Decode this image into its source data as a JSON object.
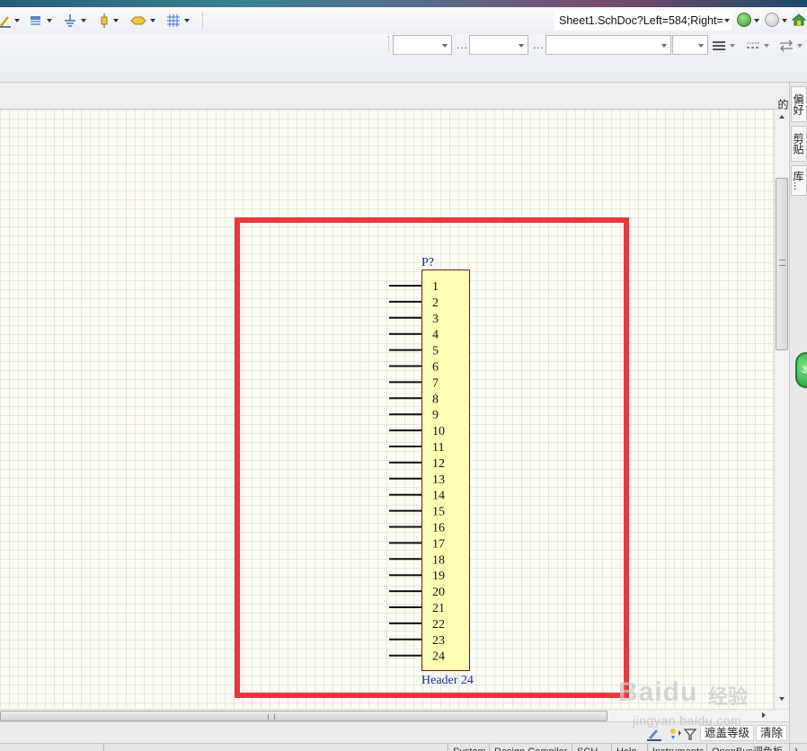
{
  "toolbar": {
    "address": "Sheet1.SchDoc?Left=584;Right=",
    "icons": [
      "wire-tool-icon",
      "bus-tool-icon",
      "power-port-icon",
      "part-icon",
      "net-label-icon",
      "grid-icon"
    ]
  },
  "right_panel": {
    "tabs": [
      "偏好的",
      "剪贴板",
      "库..."
    ]
  },
  "schematic": {
    "designator": "P?",
    "comment": "Header 24",
    "pins": [
      "1",
      "2",
      "3",
      "4",
      "5",
      "6",
      "7",
      "8",
      "9",
      "10",
      "11",
      "12",
      "13",
      "14",
      "15",
      "16",
      "17",
      "18",
      "19",
      "20",
      "21",
      "22",
      "23",
      "24"
    ],
    "body_color": "#ffffb4",
    "highlight_color": "#e8383c"
  },
  "bottom_bar": {
    "mask_level": "遮盖等级",
    "clear": "清除"
  },
  "status_bar": {
    "items": [
      "System",
      "Design Compiler",
      "SCH",
      "Help",
      "Instruments",
      "OpenBus调色板"
    ]
  },
  "float_badge": "3",
  "watermark": {
    "logo": "Baidu",
    "cn": "经验",
    "url": "jingyan.baidu.com"
  }
}
